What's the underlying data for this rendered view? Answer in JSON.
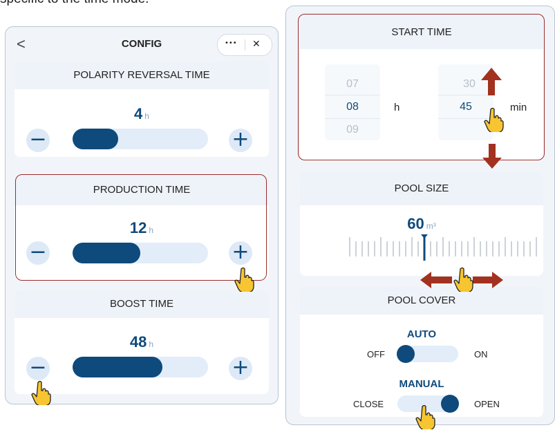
{
  "caption_fragment": "specific to the time mode.",
  "config": {
    "title": "CONFIG",
    "back_glyph": "<",
    "more_glyph": "•••",
    "close_glyph": "✕",
    "cards": [
      {
        "title": "POLARITY REVERSAL TIME",
        "value": "4",
        "unit": "h",
        "fill_fraction": 0.33
      },
      {
        "title": "PRODUCTION TIME",
        "value": "12",
        "unit": "h",
        "fill_fraction": 0.5
      },
      {
        "title": "BOOST TIME",
        "value": "48",
        "unit": "h",
        "fill_fraction": 0.66
      }
    ],
    "minus_glyph": "−",
    "plus_glyph": "+"
  },
  "start_time": {
    "title": "START TIME",
    "hours": {
      "prev": "07",
      "current": "08",
      "next": "09",
      "unit": "h"
    },
    "minutes": {
      "prev": "30",
      "current": "45",
      "unit": "min"
    }
  },
  "pool_size": {
    "title": "POOL SIZE",
    "value": "60",
    "unit": "m³"
  },
  "pool_cover": {
    "title": "POOL COVER",
    "auto": {
      "label": "AUTO",
      "off": "OFF",
      "on": "ON",
      "state": "off"
    },
    "manual": {
      "label": "MANUAL",
      "close": "CLOSE",
      "open": "OPEN",
      "state": "open"
    }
  },
  "colors": {
    "accent": "#0e4a7b",
    "highlight": "#9b2c2c",
    "arrow": "#a3311f",
    "hand": "#f7c531"
  },
  "icons": [
    "back-chevron-icon",
    "more-icon",
    "close-icon",
    "minus-icon",
    "plus-icon",
    "pointing-hand-icon",
    "arrow-up-icon",
    "arrow-down-icon",
    "arrow-left-icon",
    "arrow-right-icon"
  ]
}
